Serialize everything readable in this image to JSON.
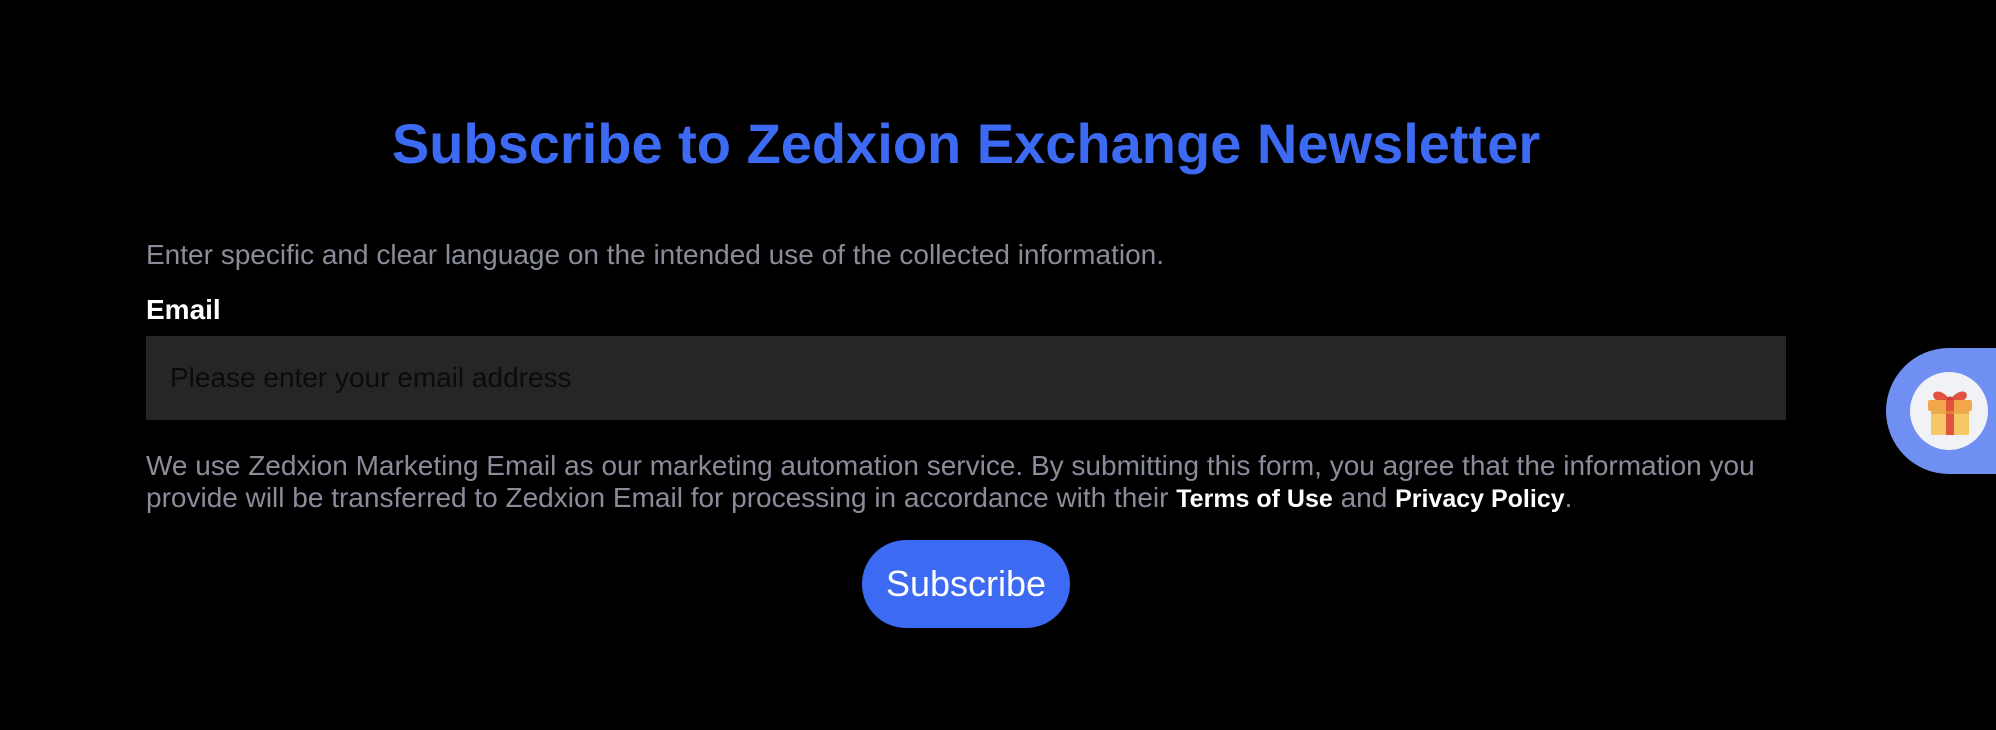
{
  "form": {
    "title": "Subscribe to Zedxion Exchange Newsletter",
    "intro": "Enter specific and clear language on the intended use of the collected information.",
    "email_label": "Email",
    "email_placeholder": "Please enter your email address",
    "email_value": "",
    "disclaimer_start": "We use Zedxion Marketing Email as our marketing automation service. By submitting this form, you agree that the information you provide will be transferred to Zedxion Email for processing in accordance with their ",
    "terms_link": "Terms of Use",
    "disclaimer_and": " and ",
    "privacy_link": "Privacy Policy",
    "disclaimer_end": ".",
    "submit_label": "Subscribe"
  },
  "widgets": {
    "gift_icon": "gift-icon"
  },
  "colors": {
    "background": "#000000",
    "accent": "#3d6af2",
    "muted_text": "#8a8d99",
    "input_bg": "#262628",
    "gift_widget_bg": "#6f8ff2"
  }
}
